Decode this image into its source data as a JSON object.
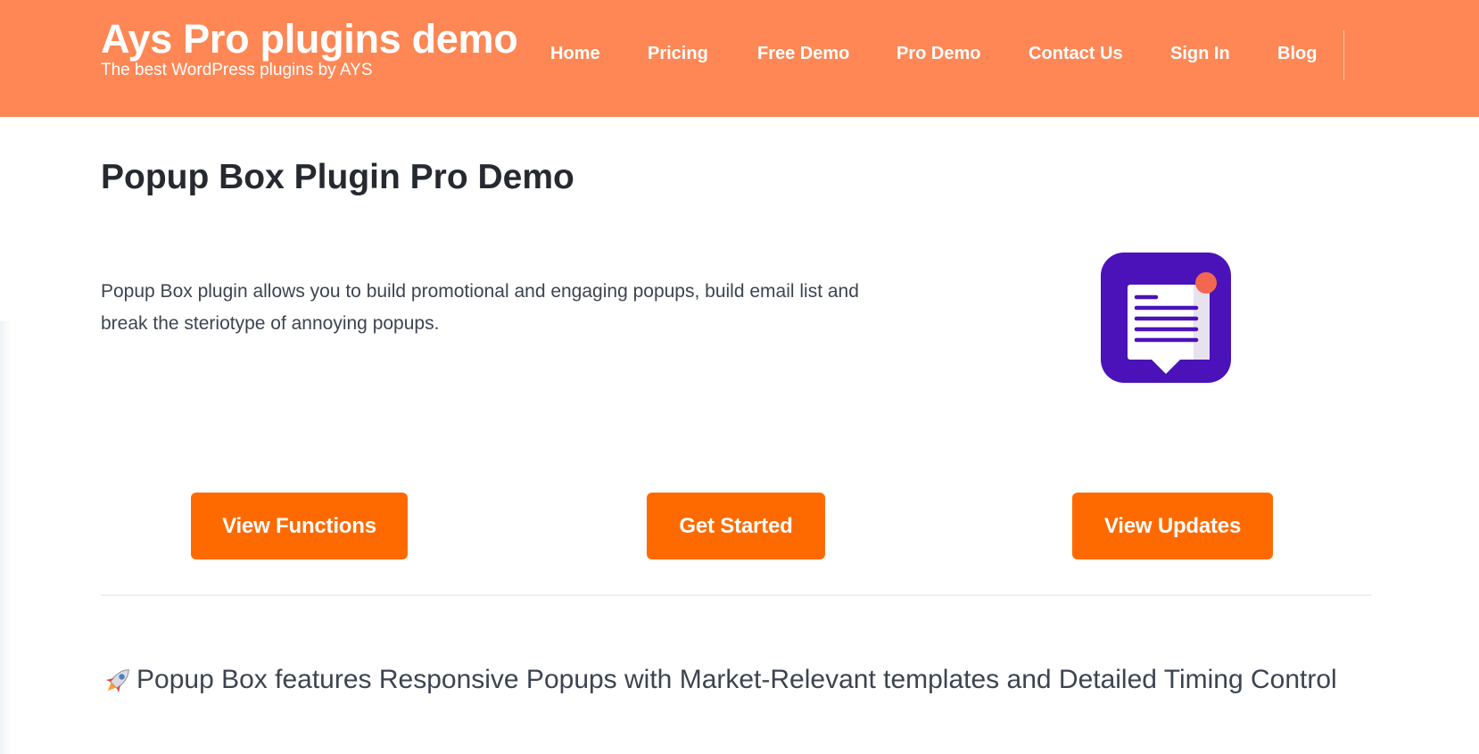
{
  "header": {
    "site_title": "Ays Pro plugins demo",
    "tagline": "The best WordPress plugins by AYS",
    "nav": [
      {
        "label": "Home"
      },
      {
        "label": "Pricing"
      },
      {
        "label": "Free Demo"
      },
      {
        "label": "Pro Demo"
      },
      {
        "label": "Contact Us"
      },
      {
        "label": "Sign In"
      },
      {
        "label": "Blog"
      }
    ]
  },
  "main": {
    "page_title": "Popup Box Plugin Pro Demo",
    "intro": "Popup Box plugin allows you to build promotional and engaging popups, build email list and break the steriotype of annoying popups.",
    "plugin_icon": "popup-box-logo-icon",
    "buttons": {
      "view_functions": "View Functions",
      "get_started": "Get Started",
      "view_updates": "View Updates"
    },
    "features_icon": "rocket-icon",
    "features_text": "Popup Box features Responsive Popups with Market-Relevant templates and Detailed Timing Control"
  },
  "colors": {
    "header_bg": "#ff8755",
    "button_bg": "#ff6a00",
    "logo_bg": "#4a12b8",
    "logo_dot": "#f2674f"
  }
}
